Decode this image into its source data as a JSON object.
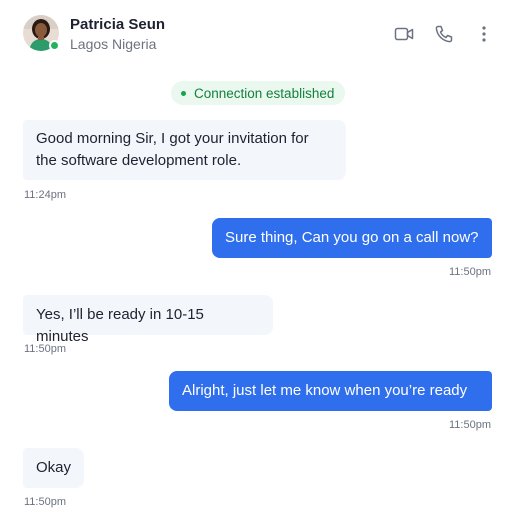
{
  "contact": {
    "name": "Patricia Seun",
    "location": "Lagos Nigeria",
    "online_color": "#22b35e"
  },
  "header_actions": {
    "video_icon": "video-camera-icon",
    "call_icon": "phone-icon",
    "more_icon": "more-vertical-icon"
  },
  "status": {
    "text": "Connection established",
    "color": "#15803d"
  },
  "messages": [
    {
      "direction": "incoming",
      "text": "Good morning Sir, I got your invitation for the software development role.",
      "time": "11:24pm"
    },
    {
      "direction": "outgoing",
      "text": "Sure thing, Can you go on a call now?",
      "time": "11:50pm"
    },
    {
      "direction": "incoming",
      "text": "Yes, I’ll be ready in 10-15 minutes",
      "time": "11:50pm"
    },
    {
      "direction": "outgoing",
      "text": "Alright, just let me know when you’re ready",
      "time": "11:50pm"
    },
    {
      "direction": "incoming",
      "text": "Okay",
      "time": "11:50pm"
    }
  ],
  "colors": {
    "outgoing_bubble": "#2f6fed",
    "incoming_bubble": "#f3f6fb"
  }
}
